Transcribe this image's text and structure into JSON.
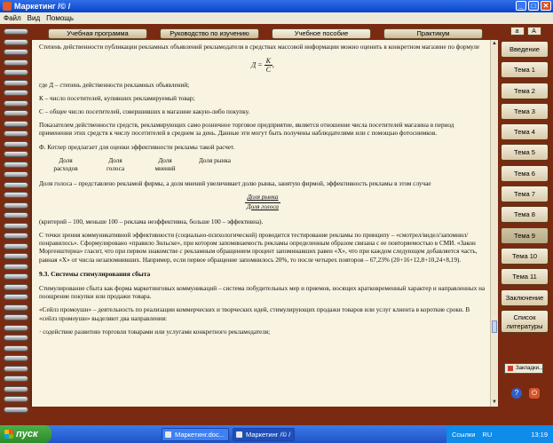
{
  "window": {
    "title": "Маркетинг /© /",
    "buttons": [
      "_",
      "□",
      "✕"
    ]
  },
  "menu": [
    "Файл",
    "Вид",
    "Помощь"
  ],
  "tabs": [
    "Учебная программа",
    "Руководство по изучению",
    "Учебное пособие",
    "Практикум"
  ],
  "active_tab": 2,
  "content": {
    "p1": "Степень действенности публикации рекламных объявлений рекламодателя в средствах массовой информации можно оценить в конкретном магазине по формуле",
    "formula1": {
      "lhs": "Д =",
      "num": "К",
      "den": "С",
      "tail": ","
    },
    "p2": "где Д – степень действенности рекламных объявлений;",
    "p3": "К – число посетителей, купивших рекламируемый товар;",
    "p4": "С – общее число посетителей, совершивших в магазине какую-либо покупку.",
    "p5": "Показателем действенности средств, рекламирующих само розничное торговое предприятие, является отношение числа посетителей магазина в период применения этих средств к числу посетителей в среднем за день. Данные эти могут быть получены наблюдателями или с помощью фотоснимков.",
    "p6": "Ф. Котлер предлагает для оценки эффективности рекламы такой расчет.",
    "kotler": [
      "Доля расходов",
      "Доля голоса",
      "Доля мнений",
      "Доля рынка"
    ],
    "p7": "Доля голоса – представлено рекламой фирмы, а доля мнений увеличивает долю рынка, занятую фирмой, эффективность рекламы в этом случае",
    "formula2": {
      "num": "Доля рынка",
      "den": "Доля голоса"
    },
    "p8": "(критерий – 100, меньше 100 – реклама неэффективна, больше 100 – эффективна).",
    "p9": "С точки зрения коммуникативной эффективности (социально-психологической) проводится тестирование рекламы по принципу – «смотрел/видел/запомнил/понравилось». Сформулировано «правило Зильске», при котором запоминаемость рекламы определенным образом связана с ее повторяемостью в СМИ. «Закон Моргенштерна» гласит, что при первом знакомстве с рекламным обращением процент запоминавших равен «Х», что при каждом следующем добавляется часть, равная «Х» от числа незапомнивших. Например, если первое обращение запомнилось 20%, то после четырех повторов – 67,23% (20+16+12,8+10,24+8,19).",
    "heading": "9.3. Системы стимулирования сбыта",
    "p10": "Стимулирование сбыта как форма маркетинговых коммуникаций – система побудительных мер и приемов, носящих кратковременный характер и направленных на поощрение покупки или продажи товара.",
    "p11": "«Сейлз промоушн» – деятельность по реализации коммерческих и творческих идей, стимулирующих продажи товаров или услуг клиента в короткие сроки. В «сейлз промоушн» выделяют два направления:",
    "p12": "· содействие развитию торговли товарами или услугами конкретного рекламодателя;"
  },
  "font_buttons": [
    "a",
    "A"
  ],
  "nav": [
    "Введение",
    "Тема 1",
    "Тема 2",
    "Тема 3",
    "Тема 4",
    "Тема 5",
    "Тема 6",
    "Тема 7",
    "Тема 8",
    "Тема 9",
    "Тема 10",
    "Тема 11",
    "Заключение",
    "Список литературы"
  ],
  "active_nav": 9,
  "bookmark_label": "Закладки...",
  "taskbar": {
    "start": "пуск",
    "tasks": [
      "Маркетинг.doc...",
      "Маркетинг /© /"
    ],
    "active_task": 1,
    "tray_left": "Ссылки",
    "lang": "RU",
    "clock": "13:19"
  }
}
